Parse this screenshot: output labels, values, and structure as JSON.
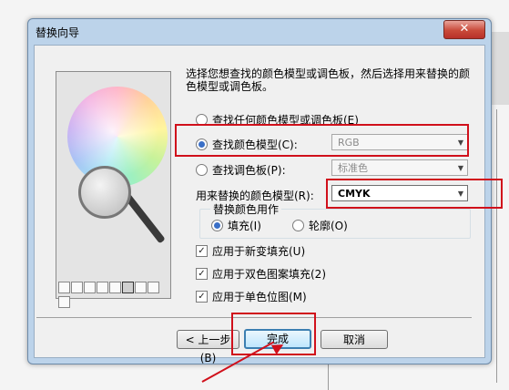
{
  "window": {
    "title": "替换向导",
    "close_symbol": "✕"
  },
  "intro_text": "选择您想查找的颜色模型或调色板，然后选择用来替换的颜色模型或调色板。",
  "find_options": {
    "any": {
      "label": "查找任何颜色模型或调色板(E)",
      "selected": false
    },
    "model": {
      "label": "查找颜色模型(C):",
      "selected": true,
      "dropdown_value": "RGB"
    },
    "palette": {
      "label": "查找调色板(P):",
      "selected": false,
      "dropdown_value": "标准色"
    }
  },
  "replace_model": {
    "label": "用来替换的颜色模型(R):",
    "dropdown_value": "CMYK"
  },
  "replace_as": {
    "group_label": "替换颜色用作",
    "fill": {
      "label": "填充(I)",
      "selected": true
    },
    "outline": {
      "label": "轮廓(O)",
      "selected": false
    }
  },
  "checkboxes": [
    {
      "label": "应用于新变填充(U)",
      "checked": true
    },
    {
      "label": "应用于双色图案填充(2)",
      "checked": true
    },
    {
      "label": "应用于单色位图(M)",
      "checked": true
    }
  ],
  "buttons": {
    "back": "< 上一步(B)",
    "finish": "完成",
    "cancel": "取消"
  },
  "icons": {
    "radio": "radio-button",
    "checkbox": "checkbox-checked",
    "dropdown": "chevron-down-icon"
  },
  "colors": {
    "annotation_red": "#d0101b",
    "dialog_frame": "#bcd3ea",
    "default_button_border": "#3c7fb1"
  }
}
